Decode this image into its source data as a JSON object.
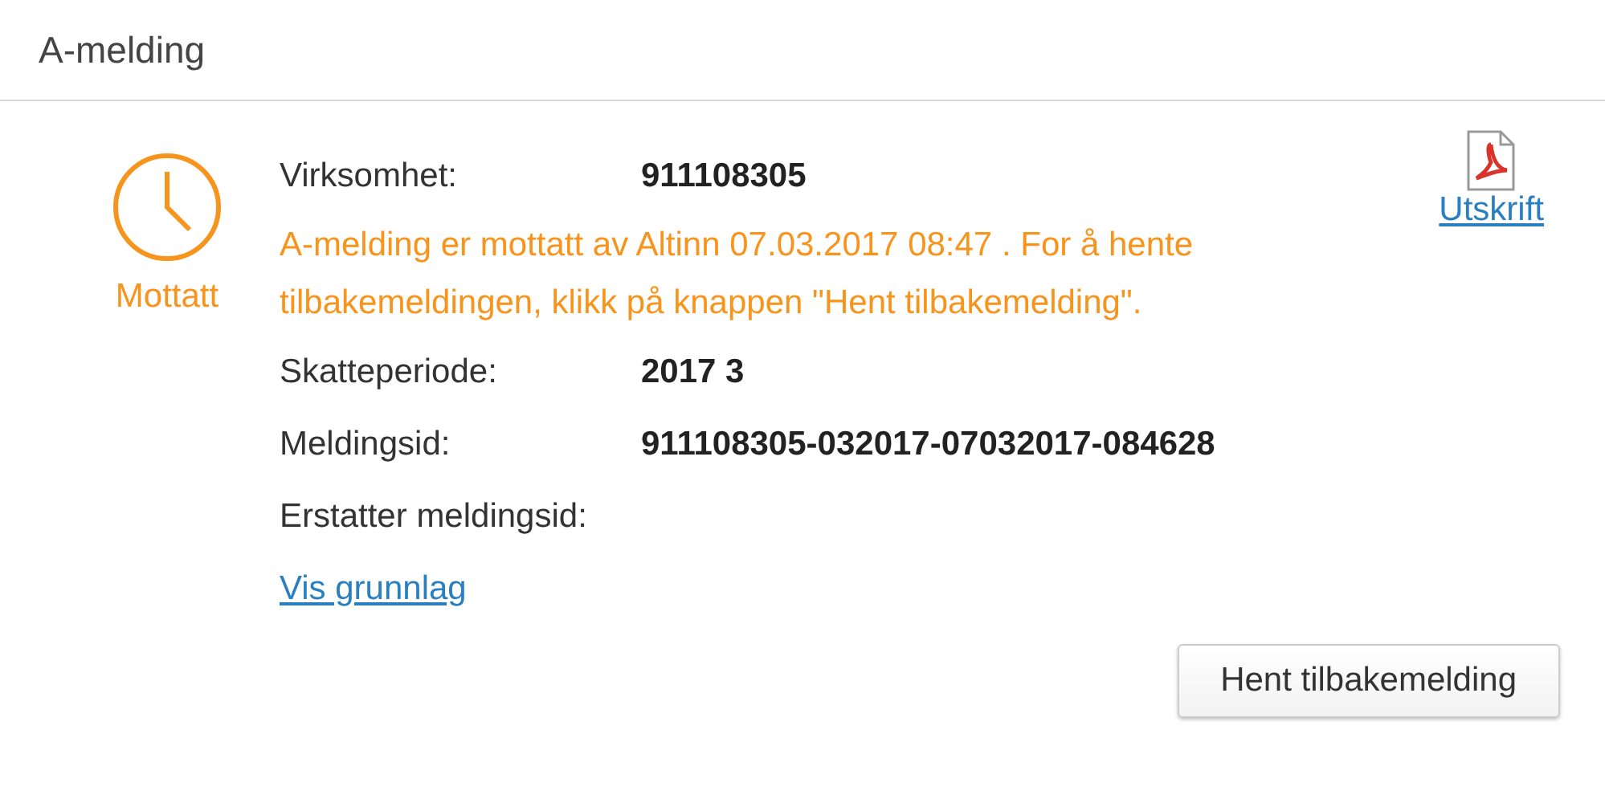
{
  "header": {
    "title": "A-melding"
  },
  "status": {
    "kind": "received",
    "label": "Mottatt"
  },
  "fields_top": [
    {
      "label": "Virksomhet:",
      "value": "911108305"
    }
  ],
  "message": "A-melding er mottatt av Altinn 07.03.2017 08:47 . For å hente tilbakemeldingen, klikk på knappen \"Hent tilbakemelding\".",
  "fields": [
    {
      "label": "Skatteperiode:",
      "value": "2017 3"
    },
    {
      "label": "Meldingsid:",
      "value": "911108305-032017-07032017-084628"
    },
    {
      "label": "Erstatter meldingsid:"
    }
  ],
  "link": "Vis grunnlag",
  "print_link": "Utskrift",
  "button": "Hent tilbakemelding"
}
